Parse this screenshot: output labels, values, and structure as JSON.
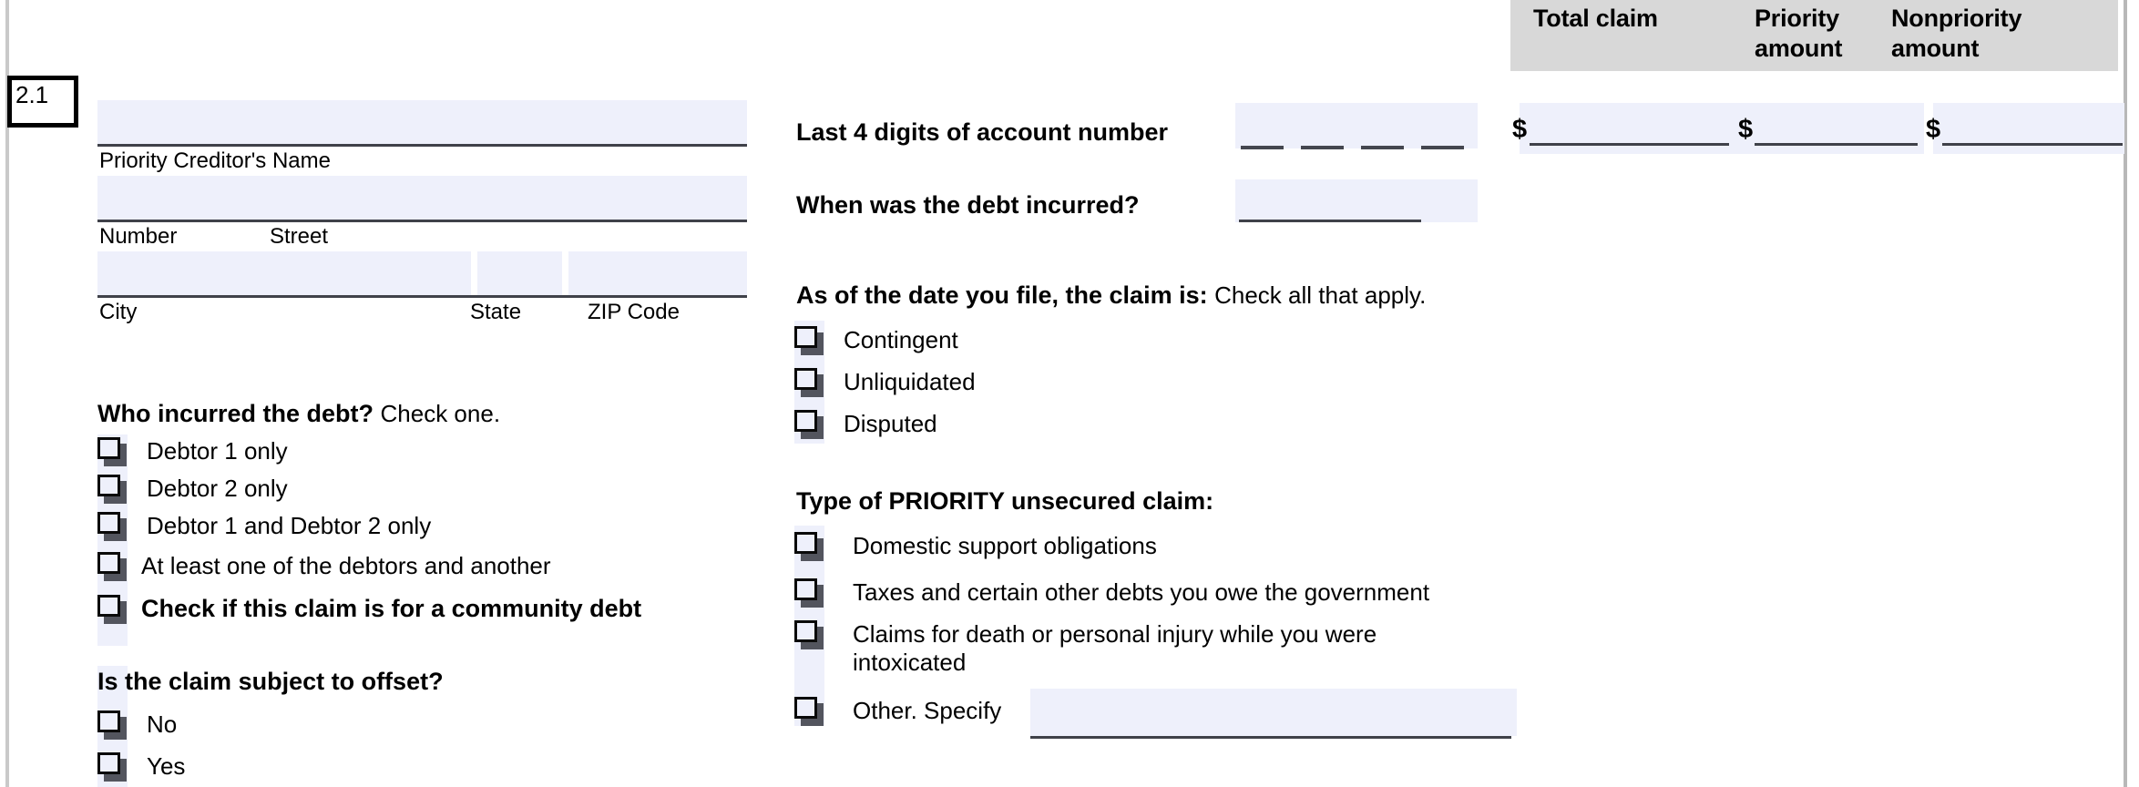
{
  "entry": {
    "number": "2.1"
  },
  "amounts_header": {
    "total_claim": "Total claim",
    "priority_amount_line1": "Priority",
    "priority_amount_line2": "amount",
    "nonpriority_amount_line1": "Nonpriority",
    "nonpriority_amount_line2": "amount",
    "currency_symbol": "$"
  },
  "creditor": {
    "name_value": "",
    "name_caption": "Priority Creditor's Name",
    "street_value": "",
    "street_caption_number": "Number",
    "street_caption_street": "Street",
    "city_value": "",
    "state_value": "",
    "zip_value": "",
    "city_caption": "City",
    "state_caption": "State",
    "zip_caption": "ZIP Code"
  },
  "account": {
    "last4_label": "Last 4 digits of account number",
    "last4_digits": [
      "",
      "",
      "",
      ""
    ],
    "incurred_label": "When was the debt incurred?",
    "incurred_value": ""
  },
  "claim_status": {
    "heading_bold": "As of the date you file, the claim is:",
    "heading_note": "Check all that apply.",
    "options": [
      {
        "label": "Contingent",
        "checked": false
      },
      {
        "label": "Unliquidated",
        "checked": false
      },
      {
        "label": "Disputed",
        "checked": false
      }
    ]
  },
  "priority_type": {
    "heading": "Type of PRIORITY unsecured claim:",
    "options": [
      {
        "label": "Domestic support obligations",
        "checked": false
      },
      {
        "label": "Taxes and certain other debts you owe the government",
        "checked": false
      },
      {
        "label": "Claims for death or personal injury while you were intoxicated",
        "checked": false
      },
      {
        "label": "Other. Specify",
        "checked": false
      }
    ],
    "other_value": ""
  },
  "who_incurred": {
    "heading_bold": "Who incurred the debt?",
    "heading_note": "Check one.",
    "options": [
      {
        "label": "Debtor 1 only",
        "checked": false,
        "bold": false
      },
      {
        "label": "Debtor 2 only",
        "checked": false,
        "bold": false
      },
      {
        "label": "Debtor 1 and Debtor 2 only",
        "checked": false,
        "bold": false
      },
      {
        "label": "At least one of the debtors and another",
        "checked": false,
        "bold": false
      },
      {
        "label": "Check if this claim is for a community debt",
        "checked": false,
        "bold": true
      }
    ]
  },
  "offset": {
    "heading": "Is the claim subject to offset?",
    "options": [
      {
        "label": "No",
        "checked": false
      },
      {
        "label": "Yes",
        "checked": false
      }
    ]
  },
  "amount_fields": {
    "total_claim_value": "",
    "priority_amount_value": "",
    "nonpriority_amount_value": ""
  },
  "colors": {
    "field_fill": "#eef0fb",
    "header_band": "#d8d8d8",
    "rule": "#44464f",
    "page_rule": "#c9c9c9"
  }
}
